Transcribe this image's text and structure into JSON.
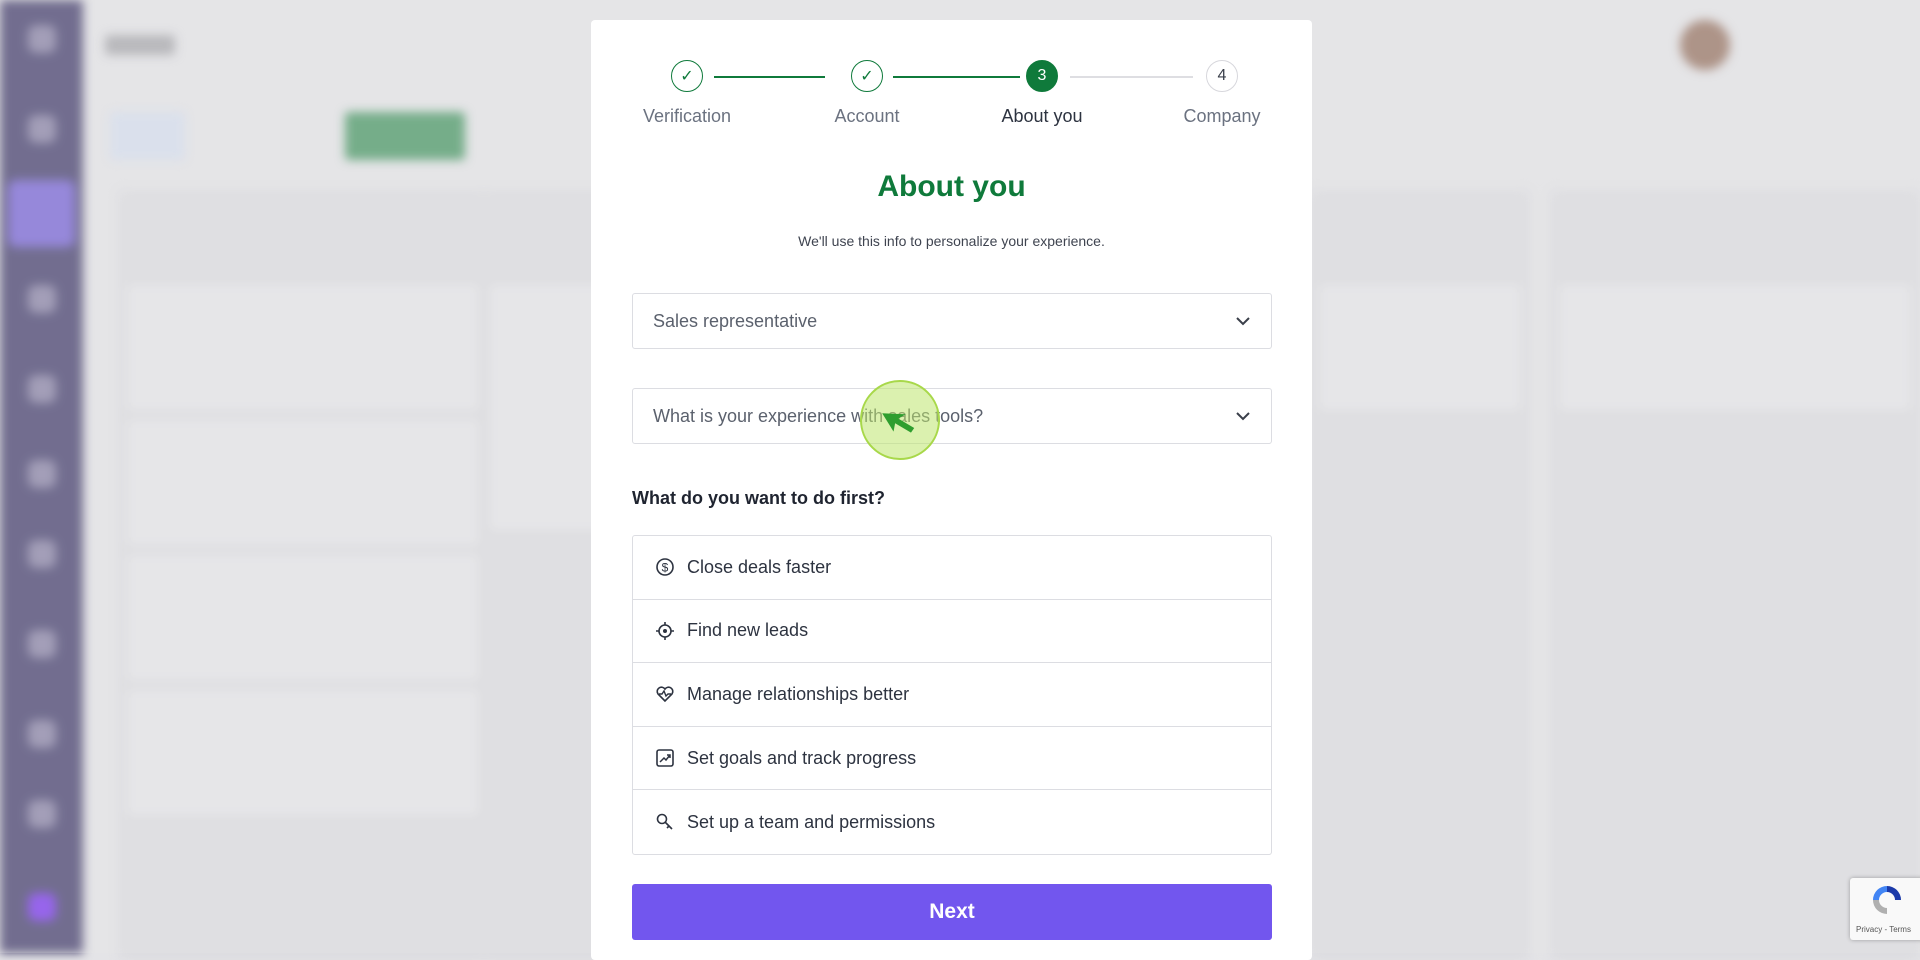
{
  "stepper": {
    "steps": [
      {
        "label": "Verification",
        "state": "done",
        "icon": "check-icon"
      },
      {
        "label": "Account",
        "state": "done",
        "icon": "check-icon"
      },
      {
        "label": "About you",
        "state": "current",
        "number": "3"
      },
      {
        "label": "Company",
        "state": "todo",
        "number": "4"
      }
    ]
  },
  "modal": {
    "title": "About you",
    "subtitle": "We'll use this info to personalize your experience.",
    "role_select": {
      "value": "Sales representative"
    },
    "experience_select": {
      "placeholder": "What is your experience with sales tools?"
    },
    "goals_heading": "What do you want to do first?",
    "goals": [
      {
        "label": "Close deals faster",
        "icon": "dollar-circle-icon"
      },
      {
        "label": "Find new leads",
        "icon": "target-icon"
      },
      {
        "label": "Manage relationships better",
        "icon": "heart-pulse-icon"
      },
      {
        "label": "Set goals and track progress",
        "icon": "chart-up-icon"
      },
      {
        "label": "Set up a team and permissions",
        "icon": "key-icon"
      }
    ],
    "next_label": "Next"
  },
  "recaptcha": {
    "text": "Privacy - Terms"
  },
  "colors": {
    "accent_green": "#0f7a3b",
    "primary_button": "#7256ee",
    "sidebar": "#4b4572"
  }
}
